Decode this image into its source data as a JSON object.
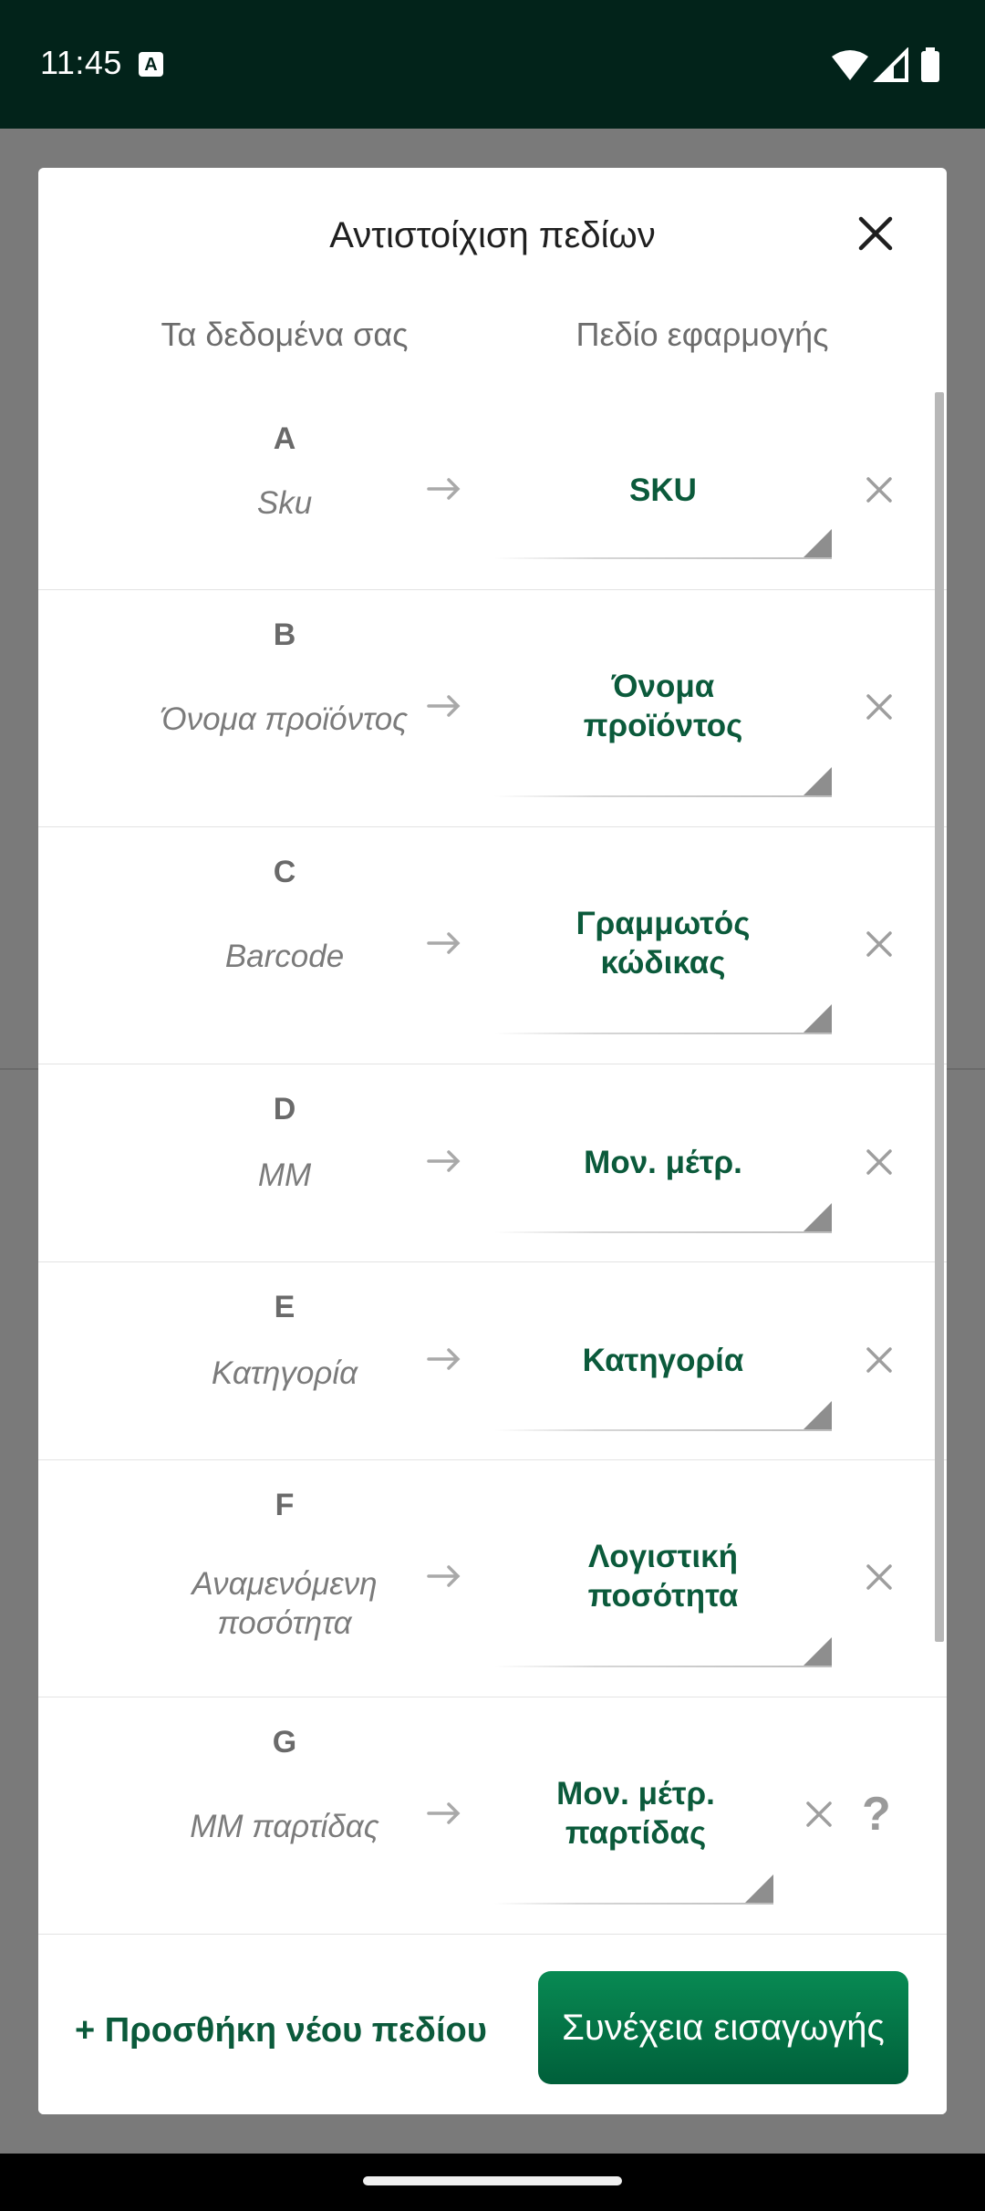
{
  "status_bar": {
    "time": "11:45",
    "notification_badge": "A"
  },
  "dialog": {
    "title": "Αντιστοίχιση πεδίων",
    "col_left": "Τα δεδομένα σας",
    "col_right": "Πεδίο εφαρμογής",
    "rows": [
      {
        "letter": "A",
        "source": "Sku",
        "target": "SKU"
      },
      {
        "letter": "B",
        "source": "Όνομα προϊόντος",
        "target": "Όνομα προϊόντος"
      },
      {
        "letter": "C",
        "source": "Barcode",
        "target": "Γραμμωτός κώδικας"
      },
      {
        "letter": "D",
        "source": "ΜΜ",
        "target": "Μον. μέτρ."
      },
      {
        "letter": "E",
        "source": "Κατηγορία",
        "target": "Κατηγορία"
      },
      {
        "letter": "F",
        "source": "Αναμενόμενη ποσότητα",
        "target": "Λογιστική ποσότητα"
      },
      {
        "letter": "G",
        "source": "ΜΜ παρτίδας",
        "target": "Μον. μέτρ. παρτίδας",
        "help": "?"
      }
    ],
    "add_field_label": "+ Προσθήκη νέου πεδίου",
    "continue_label": "Συνέχεια εισαγωγής"
  },
  "colors": {
    "accent": "#0b5a3b",
    "button": "#088a53",
    "status_bar": "#02231a"
  }
}
